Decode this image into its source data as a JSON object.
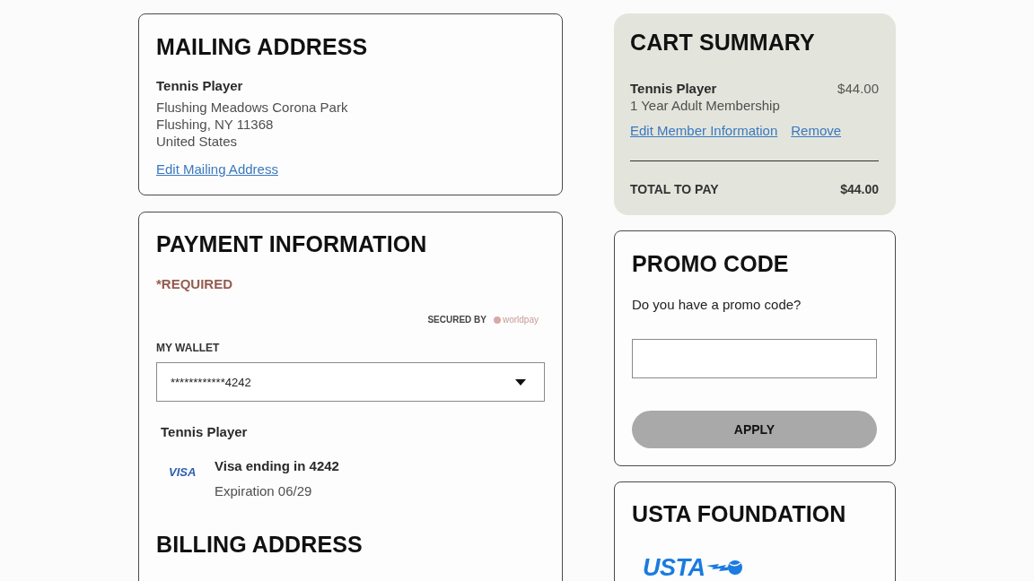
{
  "mailing_address": {
    "title": "MAILING ADDRESS",
    "name": "Tennis Player",
    "lines": [
      "Flushing Meadows Corona Park",
      "Flushing, NY 11368",
      "United States"
    ],
    "edit_link": "Edit Mailing Address"
  },
  "payment_information": {
    "title": "PAYMENT INFORMATION",
    "required_note": "*REQUIRED",
    "secured_by": {
      "label": "SECURED BY",
      "logo_text": "worldpay"
    },
    "wallet": {
      "label": "MY WALLET",
      "value": "************4242"
    },
    "cardholder": "Tennis Player",
    "card": {
      "logo_text": "VISA",
      "description": "Visa ending in 4242",
      "expiration": "Expiration 06/29"
    },
    "billing_address": {
      "title": "BILLING ADDRESS"
    }
  },
  "cart_summary": {
    "title": "CART SUMMARY",
    "items": [
      {
        "name": "Tennis Player",
        "product": "1 Year Adult Membership",
        "price": "$44.00",
        "links": [
          "Edit Member Information",
          "Remove"
        ]
      }
    ],
    "total_label": "TOTAL TO PAY",
    "total": "$44.00"
  },
  "promo_code": {
    "title": "PROMO CODE",
    "prompt": "Do you have a promo code?",
    "apply_button": {
      "label": "APPLY",
      "disabled": true
    }
  },
  "usta_foundation": {
    "title": "USTA FOUNDATION",
    "logo_text": "USTA"
  }
}
